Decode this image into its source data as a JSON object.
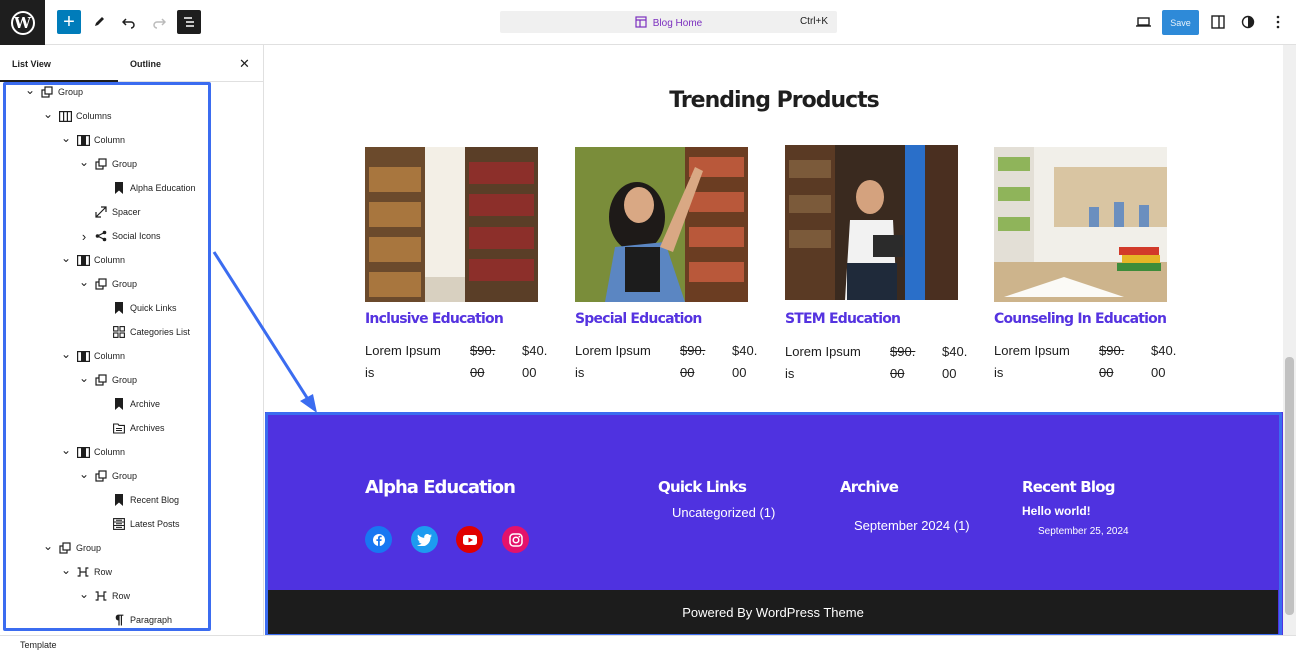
{
  "topbar": {
    "document_title": "Blog Home",
    "shortcut": "Ctrl+K",
    "save_label": "Save"
  },
  "sidebar": {
    "tab_listview": "List View",
    "tab_outline": "Outline",
    "items": [
      {
        "label": "Group",
        "icon": "group-icon",
        "chevron": "down"
      },
      {
        "label": "Columns",
        "icon": "columns-icon",
        "chevron": "down"
      },
      {
        "label": "Column",
        "icon": "column-icon",
        "chevron": "down"
      },
      {
        "label": "Group",
        "icon": "group-icon",
        "chevron": "down"
      },
      {
        "label": "Alpha Education",
        "icon": "bookmark-icon",
        "chevron": "none"
      },
      {
        "label": "Spacer",
        "icon": "spacer-icon",
        "chevron": "none"
      },
      {
        "label": "Social Icons",
        "icon": "share-icon",
        "chevron": "right"
      },
      {
        "label": "Column",
        "icon": "column-icon",
        "chevron": "down"
      },
      {
        "label": "Group",
        "icon": "group-icon",
        "chevron": "down"
      },
      {
        "label": "Quick Links",
        "icon": "bookmark-icon",
        "chevron": "none"
      },
      {
        "label": "Categories List",
        "icon": "categories-icon",
        "chevron": "none"
      },
      {
        "label": "Column",
        "icon": "column-icon",
        "chevron": "down"
      },
      {
        "label": "Group",
        "icon": "group-icon",
        "chevron": "down"
      },
      {
        "label": "Archive",
        "icon": "bookmark-icon",
        "chevron": "none"
      },
      {
        "label": "Archives",
        "icon": "archives-icon",
        "chevron": "none"
      },
      {
        "label": "Column",
        "icon": "column-icon",
        "chevron": "down"
      },
      {
        "label": "Group",
        "icon": "group-icon",
        "chevron": "down"
      },
      {
        "label": "Recent Blog",
        "icon": "bookmark-icon",
        "chevron": "none"
      },
      {
        "label": "Latest Posts",
        "icon": "latest-posts-icon",
        "chevron": "none"
      },
      {
        "label": "Group",
        "icon": "group-icon",
        "chevron": "down"
      },
      {
        "label": "Row",
        "icon": "row-icon",
        "chevron": "down"
      },
      {
        "label": "Row",
        "icon": "row-icon",
        "chevron": "down"
      },
      {
        "label": "Paragraph",
        "icon": "paragraph-icon",
        "chevron": "none"
      }
    ]
  },
  "template_footer": "Template",
  "canvas": {
    "section_title": "Trending Products",
    "products": [
      {
        "name": "Inclusive Education",
        "text1": "Lorem Ipsum",
        "text2": "is",
        "old1": "$90.",
        "old2": "00",
        "new1": "$40.",
        "new2": "00"
      },
      {
        "name": "Special Education",
        "text1": "Lorem Ipsum",
        "text2": "is",
        "old1": "$90.",
        "old2": "00",
        "new1": "$40.",
        "new2": "00"
      },
      {
        "name": "STEM Education",
        "text1": "Lorem Ipsum",
        "text2": "is",
        "old1": "$90.",
        "old2": "00",
        "new1": "$40.",
        "new2": "00"
      },
      {
        "name": "Counseling In Education",
        "text1": "Lorem Ipsum",
        "text2": "is",
        "old1": "$90.",
        "old2": "00",
        "new1": "$40.",
        "new2": "00"
      }
    ],
    "footer": {
      "brand": "Alpha Education",
      "quick_links_heading": "Quick Links",
      "quick_link_1": "Uncategorized (1)",
      "archive_heading": "Archive",
      "archive_1": "September 2024 (1)",
      "recent_heading": "Recent Blog",
      "recent_post_title": "Hello world!",
      "recent_post_date": "September 25, 2024",
      "powered_by": "Powered By WordPress Theme"
    }
  },
  "colors": {
    "accent": "#5533e0",
    "footer_bg": "#4f32e0",
    "selection": "#3b6cf0",
    "wp_blue": "#007cba"
  }
}
